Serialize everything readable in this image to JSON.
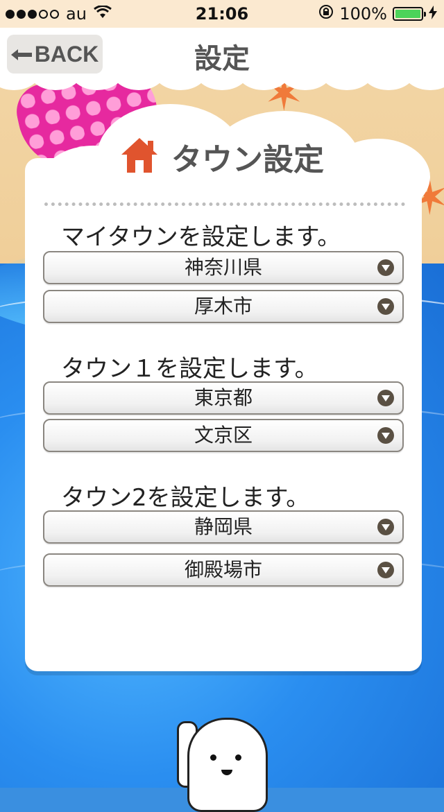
{
  "status_bar": {
    "carrier": "au",
    "time": "21:06",
    "battery_percent": "100%"
  },
  "header": {
    "back_label": "BACK",
    "title": "設定"
  },
  "panel": {
    "title": "タウン設定",
    "icon": "home-icon",
    "sections": [
      {
        "label": "マイタウンを設定します。",
        "prefecture": "神奈川県",
        "city": "厚木市"
      },
      {
        "label": "タウン１を設定します。",
        "prefecture": "東京都",
        "city": "文京区"
      },
      {
        "label": "タウン2を設定します。",
        "prefecture": "静岡県",
        "city": "御殿場市"
      }
    ]
  },
  "colors": {
    "accent_home": "#e0542e",
    "battery": "#4cd35a",
    "chevron": "#5a5043"
  }
}
